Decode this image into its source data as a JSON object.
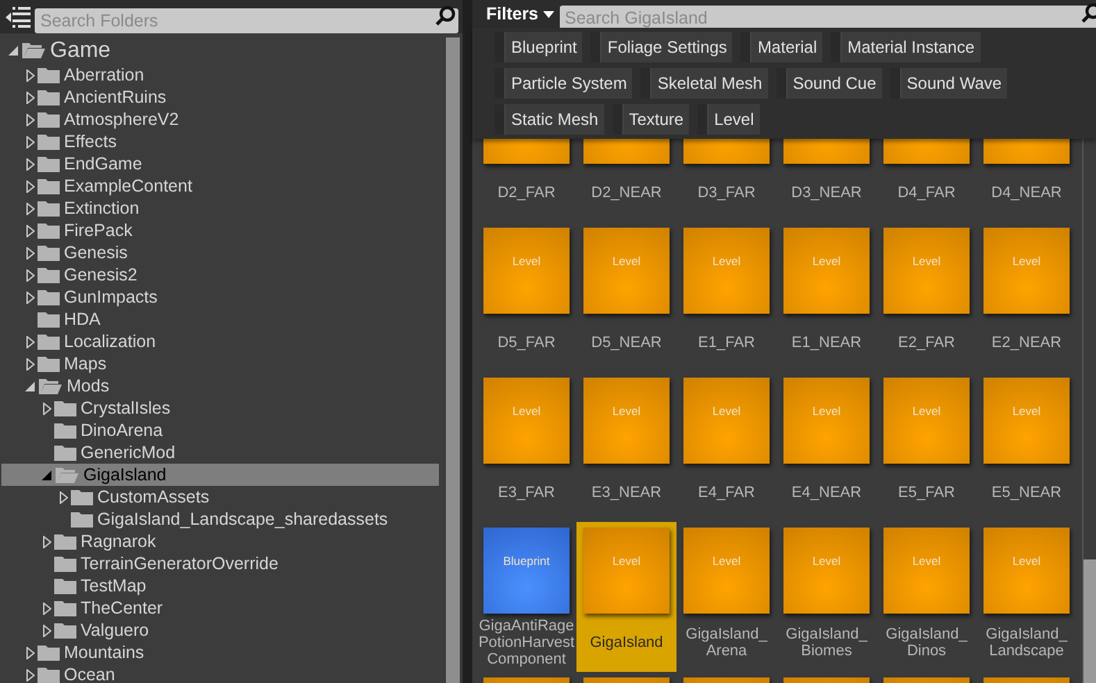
{
  "folders": {
    "search": {
      "placeholder": "Search Folders"
    },
    "tree": [
      {
        "label": "Game",
        "expandable": true,
        "expanded": true,
        "selected": false,
        "children": [
          {
            "label": "Aberration",
            "expandable": true,
            "expanded": false,
            "selected": false
          },
          {
            "label": "AncientRuins",
            "expandable": true,
            "expanded": false,
            "selected": false
          },
          {
            "label": "AtmosphereV2",
            "expandable": true,
            "expanded": false,
            "selected": false
          },
          {
            "label": "Effects",
            "expandable": true,
            "expanded": false,
            "selected": false
          },
          {
            "label": "EndGame",
            "expandable": true,
            "expanded": false,
            "selected": false
          },
          {
            "label": "ExampleContent",
            "expandable": true,
            "expanded": false,
            "selected": false
          },
          {
            "label": "Extinction",
            "expandable": true,
            "expanded": false,
            "selected": false
          },
          {
            "label": "FirePack",
            "expandable": true,
            "expanded": false,
            "selected": false
          },
          {
            "label": "Genesis",
            "expandable": true,
            "expanded": false,
            "selected": false
          },
          {
            "label": "Genesis2",
            "expandable": true,
            "expanded": false,
            "selected": false
          },
          {
            "label": "GunImpacts",
            "expandable": true,
            "expanded": false,
            "selected": false
          },
          {
            "label": "HDA",
            "expandable": false,
            "expanded": false,
            "selected": false
          },
          {
            "label": "Localization",
            "expandable": true,
            "expanded": false,
            "selected": false
          },
          {
            "label": "Maps",
            "expandable": true,
            "expanded": false,
            "selected": false
          },
          {
            "label": "Mods",
            "expandable": true,
            "expanded": true,
            "selected": false,
            "children": [
              {
                "label": "CrystalIsles",
                "expandable": true,
                "expanded": false,
                "selected": false
              },
              {
                "label": "DinoArena",
                "expandable": false,
                "expanded": false,
                "selected": false
              },
              {
                "label": "GenericMod",
                "expandable": false,
                "expanded": false,
                "selected": false
              },
              {
                "label": "GigaIsland",
                "expandable": true,
                "expanded": true,
                "selected": true,
                "children": [
                  {
                    "label": "CustomAssets",
                    "expandable": true,
                    "expanded": false,
                    "selected": false
                  },
                  {
                    "label": "GigaIsland_Landscape_sharedassets",
                    "expandable": false,
                    "expanded": false,
                    "selected": false
                  }
                ]
              },
              {
                "label": "Ragnarok",
                "expandable": true,
                "expanded": false,
                "selected": false
              },
              {
                "label": "TerrainGeneratorOverride",
                "expandable": false,
                "expanded": false,
                "selected": false
              },
              {
                "label": "TestMap",
                "expandable": false,
                "expanded": false,
                "selected": false
              },
              {
                "label": "TheCenter",
                "expandable": true,
                "expanded": false,
                "selected": false
              },
              {
                "label": "Valguero",
                "expandable": true,
                "expanded": false,
                "selected": false
              }
            ]
          },
          {
            "label": "Mountains",
            "expandable": true,
            "expanded": false,
            "selected": false
          },
          {
            "label": "Ocean",
            "expandable": true,
            "expanded": false,
            "selected": false
          }
        ]
      }
    ]
  },
  "content": {
    "filters_button": "Filters",
    "search": {
      "placeholder": "Search GigaIsland"
    },
    "filter_chips": [
      "Blueprint",
      "Foliage Settings",
      "Material",
      "Material Instance",
      "Particle System",
      "Skeletal Mesh",
      "Sound Cue",
      "Sound Wave",
      "Static Mesh",
      "Texture",
      "Level"
    ],
    "assets": [
      {
        "name": "D2_FAR",
        "kind": "level",
        "selected": false
      },
      {
        "name": "D2_NEAR",
        "kind": "level",
        "selected": false
      },
      {
        "name": "D3_FAR",
        "kind": "level",
        "selected": false
      },
      {
        "name": "D3_NEAR",
        "kind": "level",
        "selected": false
      },
      {
        "name": "D4_FAR",
        "kind": "level",
        "selected": false
      },
      {
        "name": "D4_NEAR",
        "kind": "level",
        "selected": false
      },
      {
        "name": "D5_FAR",
        "kind": "level",
        "type": "Level",
        "selected": false
      },
      {
        "name": "D5_NEAR",
        "kind": "level",
        "type": "Level",
        "selected": false
      },
      {
        "name": "E1_FAR",
        "kind": "level",
        "type": "Level",
        "selected": false
      },
      {
        "name": "E1_NEAR",
        "kind": "level",
        "type": "Level",
        "selected": false
      },
      {
        "name": "E2_FAR",
        "kind": "level",
        "type": "Level",
        "selected": false
      },
      {
        "name": "E2_NEAR",
        "kind": "level",
        "type": "Level",
        "selected": false
      },
      {
        "name": "E3_FAR",
        "kind": "level",
        "type": "Level",
        "selected": false
      },
      {
        "name": "E3_NEAR",
        "kind": "level",
        "type": "Level",
        "selected": false
      },
      {
        "name": "E4_FAR",
        "kind": "level",
        "type": "Level",
        "selected": false
      },
      {
        "name": "E4_NEAR",
        "kind": "level",
        "type": "Level",
        "selected": false
      },
      {
        "name": "E5_FAR",
        "kind": "level",
        "type": "Level",
        "selected": false
      },
      {
        "name": "E5_NEAR",
        "kind": "level",
        "type": "Level",
        "selected": false
      },
      {
        "name": "GigaAntiRage PotionHarvest Component",
        "kind": "blueprint",
        "type": "Blueprint",
        "selected": false
      },
      {
        "name": "GigaIsland",
        "kind": "level",
        "type": "Level",
        "selected": true
      },
      {
        "name": "GigaIsland_ Arena",
        "kind": "level",
        "type": "Level",
        "selected": false
      },
      {
        "name": "GigaIsland_ Biomes",
        "kind": "level",
        "type": "Level",
        "selected": false
      },
      {
        "name": "GigaIsland_ Dinos",
        "kind": "level",
        "type": "Level",
        "selected": false
      },
      {
        "name": "GigaIsland_ Landscape",
        "kind": "level",
        "type": "Level",
        "selected": false
      },
      {
        "kind": "level",
        "selected": false
      },
      {
        "kind": "level",
        "selected": false
      },
      {
        "kind": "level",
        "selected": false
      },
      {
        "kind": "level",
        "selected": false
      },
      {
        "kind": "level",
        "selected": false
      },
      {
        "kind": "level",
        "selected": false
      }
    ]
  }
}
